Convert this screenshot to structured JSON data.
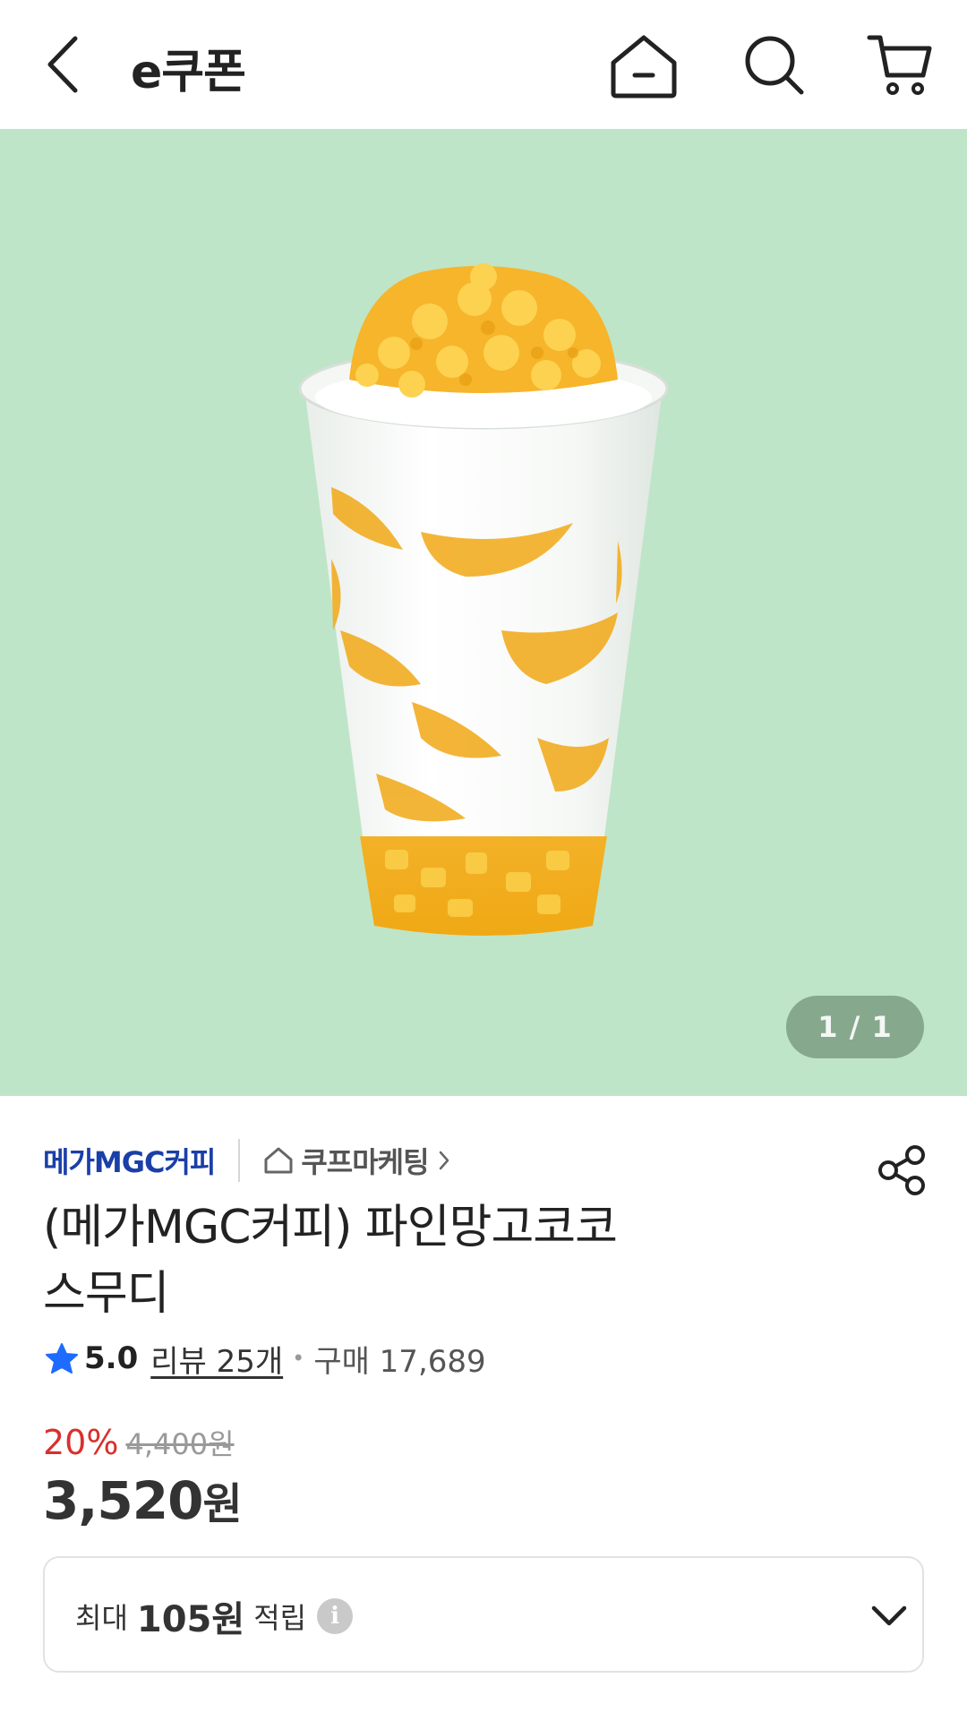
{
  "header": {
    "title": "e쿠폰",
    "back_icon": "chevron-left-icon",
    "home_icon": "home-icon",
    "search_icon": "search-icon",
    "cart_icon": "cart-icon"
  },
  "hero": {
    "pager": "1 / 1",
    "background_color": "#bfe5c8"
  },
  "product": {
    "brand": "메가MGC커피",
    "store": "쿠프마케팅",
    "title_line1": "(메가MGC커피) 파인망고코코",
    "title_line2": "스무디",
    "rating": "5.0",
    "review_text": "리뷰 25개",
    "purchase_text": "구매 17,689",
    "discount": "20%",
    "original_price": "4,400원",
    "price_amount": "3,520",
    "price_unit": "원"
  },
  "points": {
    "prefix": "최대",
    "amount": "105원",
    "suffix": "적립",
    "info_glyph": "i"
  },
  "colors": {
    "brand": "#1a3fa8",
    "discount": "#d9302c",
    "star": "#1e6bff"
  }
}
